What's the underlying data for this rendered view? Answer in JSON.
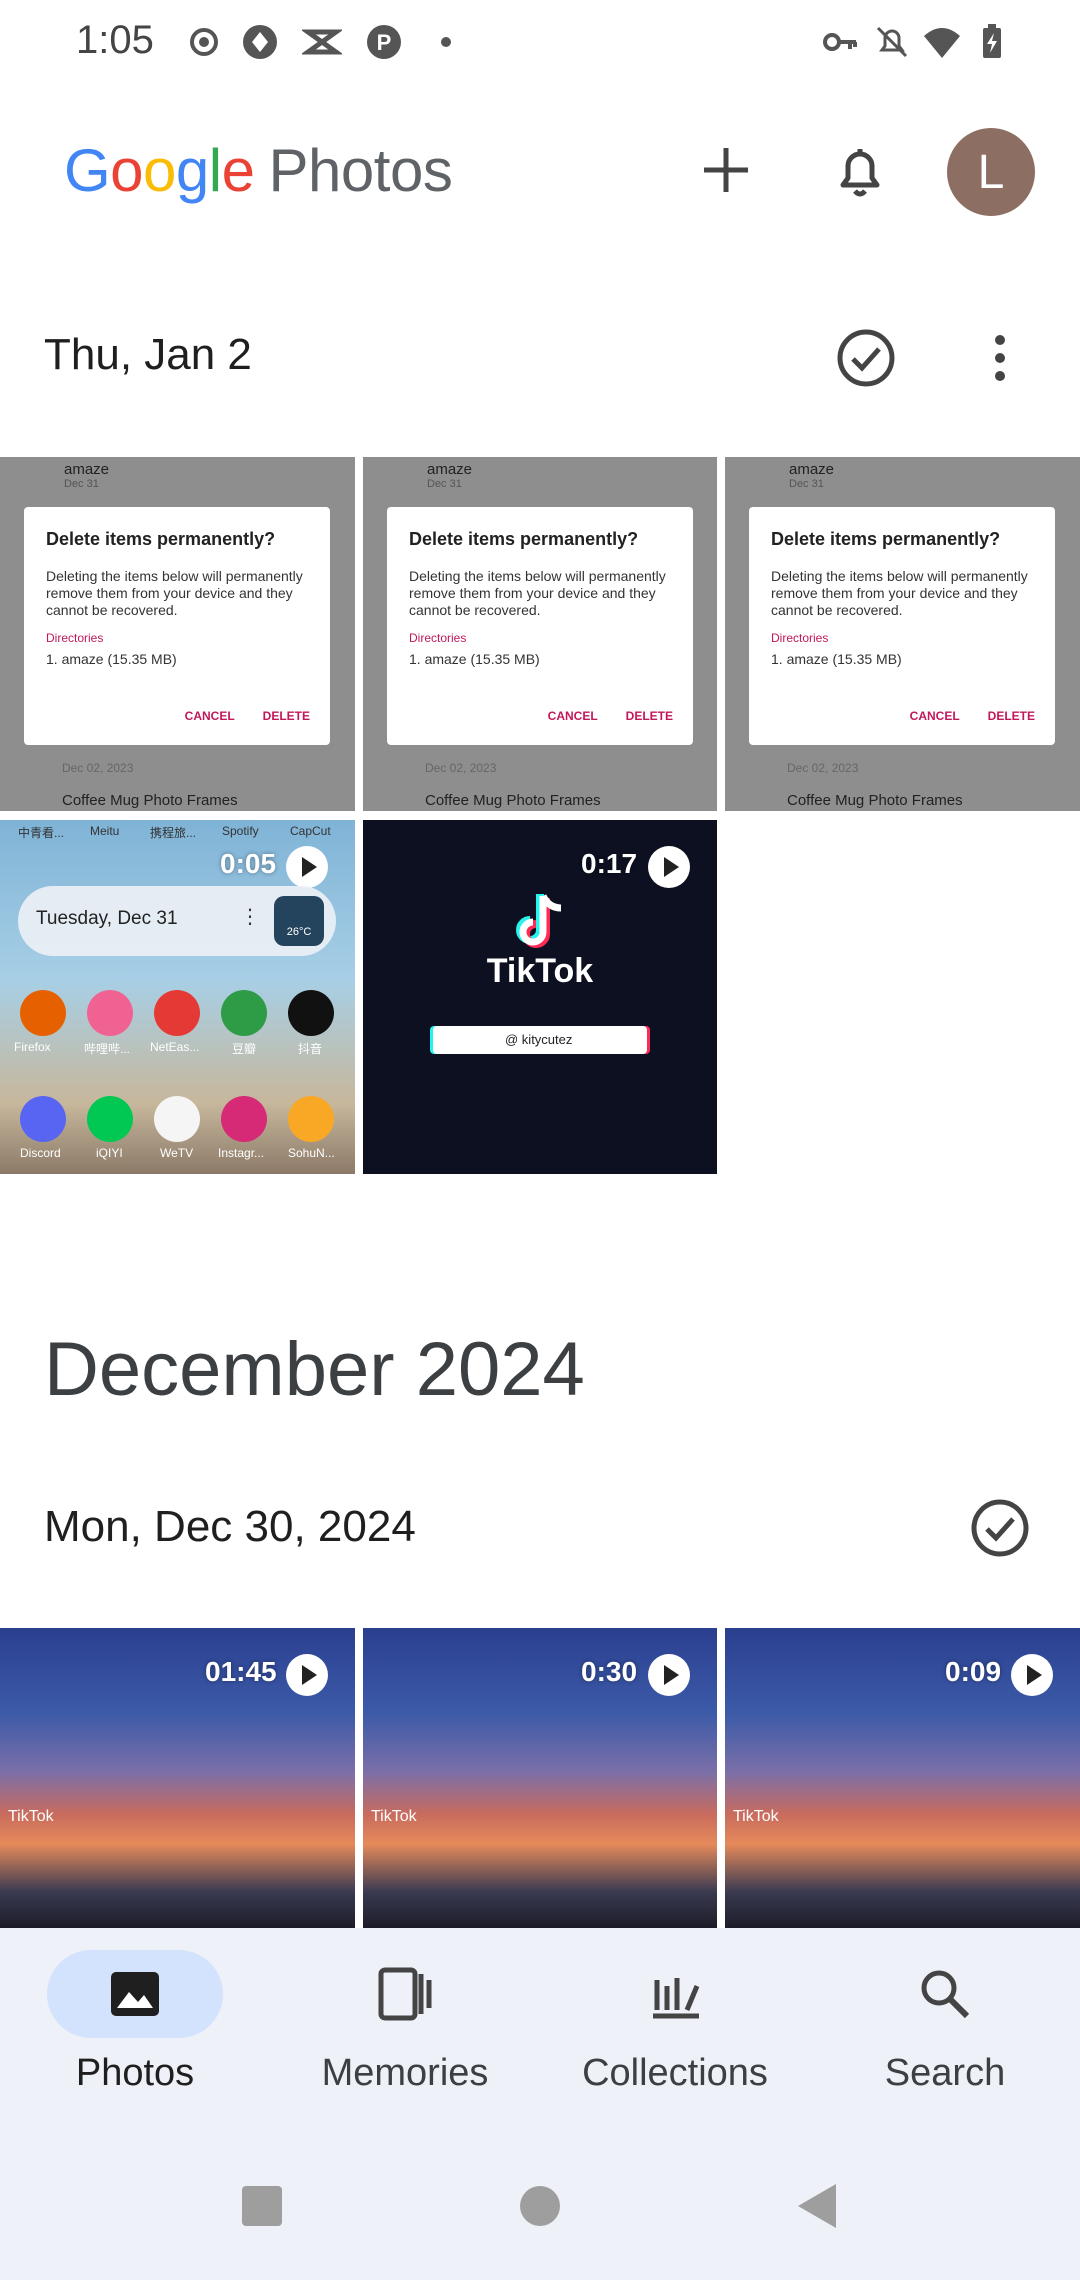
{
  "status_bar": {
    "time": "1:05"
  },
  "app_bar": {
    "logo_google": "Google",
    "logo_product": "Photos",
    "avatar_letter": "L"
  },
  "sections": [
    {
      "date": "Thu, Jan 2"
    },
    {
      "date": "Mon, Dec 30, 2024"
    }
  ],
  "month_header": "December 2024",
  "dialog_screenshot": {
    "folder_name": "amaze",
    "folder_date": "Dec 31",
    "title": "Delete items permanently?",
    "body": "Deleting the items below will permanently remove them from your device and they cannot be recovered.",
    "directories_label": "Directories",
    "item": "1. amaze (15.35 MB)",
    "cancel": "CANCEL",
    "delete": "DELETE",
    "bottom_date": "Dec 02, 2023",
    "bottom_item": "Coffee Mug Photo Frames"
  },
  "home_video": {
    "duration": "0:05",
    "date_widget": "Tuesday, Dec 31",
    "weather": "26°C",
    "top_apps": [
      "中青看...",
      "Meitu",
      "携程旅...",
      "Spotify",
      "CapCut"
    ],
    "row1_apps": [
      "Firefox",
      "哔哩哔...",
      "NetEas...",
      "豆瓣",
      "抖音"
    ],
    "row2_apps": [
      "Discord",
      "iQIYI",
      "WeTV",
      "Instagr...",
      "SohuN..."
    ]
  },
  "tiktok_video": {
    "duration": "0:17",
    "brand": "TikTok",
    "handle": "@ kitycutez"
  },
  "sky_videos": [
    {
      "duration": "01:45"
    },
    {
      "duration": "0:30"
    },
    {
      "duration": "0:09"
    }
  ],
  "sky_watermark": "TikTok",
  "bottom_nav": [
    {
      "label": "Photos",
      "icon": "photo-icon",
      "active": true
    },
    {
      "label": "Memories",
      "icon": "memories-icon",
      "active": false
    },
    {
      "label": "Collections",
      "icon": "collections-icon",
      "active": false
    },
    {
      "label": "Search",
      "icon": "search-icon",
      "active": false
    }
  ],
  "colors": {
    "accent_pill": "#d3e3fd",
    "nav_bg": "#eef1f8",
    "avatar": "#8d6e63"
  }
}
